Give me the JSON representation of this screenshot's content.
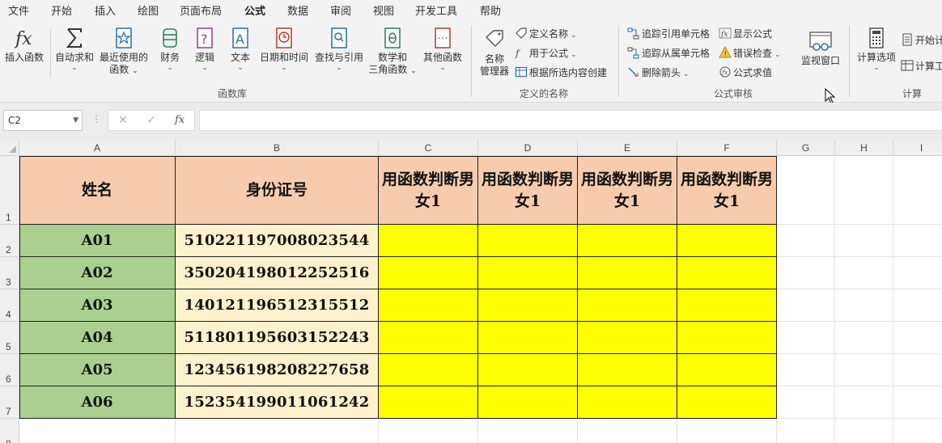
{
  "menu": {
    "tabs": [
      "文件",
      "开始",
      "插入",
      "绘图",
      "页面布局",
      "公式",
      "数据",
      "审阅",
      "视图",
      "开发工具",
      "帮助"
    ],
    "active_tab": "公式"
  },
  "ribbon": {
    "function_library": {
      "insert_function": "插入函数",
      "autosum": "自动求和",
      "recent_line1": "最近使用的",
      "recent_line2": "函数",
      "financial": "财务",
      "logical": "逻辑",
      "text": "文本",
      "datetime": "日期和时间",
      "lookup": "查找与引用",
      "math_line1": "数学和",
      "math_line2": "三角函数",
      "more": "其他函数",
      "group_label": "函数库"
    },
    "defined_names": {
      "name_manager_line1": "名称",
      "name_manager_line2": "管理器",
      "define_name": "定义名称",
      "use_in_formula": "用于公式",
      "create_from_selection": "根据所选内容创建",
      "group_label": "定义的名称"
    },
    "formula_auditing": {
      "trace_precedents": "追踪引用单元格",
      "trace_dependents": "追踪从属单元格",
      "remove_arrows": "删除箭头",
      "show_formulas": "显示公式",
      "error_checking": "错误检查",
      "evaluate_formula": "公式求值",
      "group_label": "公式审核"
    },
    "watch_window": "监视窗口",
    "calculation": {
      "options": "计算选项",
      "calc_now": "开始计",
      "calc_sheet": "计算工",
      "group_label": "计算"
    }
  },
  "formula_bar": {
    "name_box": "C2",
    "cancel": "✕",
    "enter": "✓",
    "fx": "fx",
    "value": ""
  },
  "sheet": {
    "columns": [
      "A",
      "B",
      "C",
      "D",
      "E",
      "F",
      "G",
      "H",
      "I"
    ],
    "rows": [
      "1",
      "2",
      "3",
      "4",
      "5",
      "6",
      "7",
      "8"
    ],
    "header_row": {
      "name": "姓名",
      "id": "身份证号",
      "judge_c": "用函数判断男女1",
      "judge_d": "用函数判断男女1",
      "judge_e": "用函数判断男女1",
      "judge_f": "用函数判断男女1"
    },
    "records": [
      {
        "name": "A01",
        "id": "510221197008023544"
      },
      {
        "name": "A02",
        "id": "350204198012252516"
      },
      {
        "name": "A03",
        "id": "140121196512315512"
      },
      {
        "name": "A04",
        "id": "511801195603152243"
      },
      {
        "name": "A05",
        "id": "123456198208227658"
      },
      {
        "name": "A06",
        "id": "152354199011061242"
      }
    ]
  },
  "colors": {
    "header_fill": "#f8cbad",
    "name_fill": "#a9d08e",
    "id_fill": "#fff2cc",
    "result_fill": "#ffff00",
    "accent": "#217346"
  }
}
